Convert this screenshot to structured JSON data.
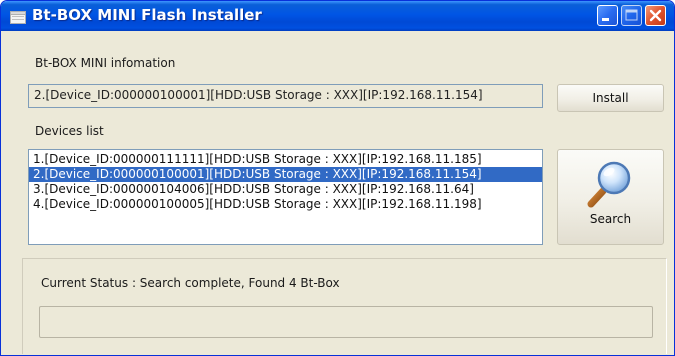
{
  "window": {
    "title": "Bt-BOX MINI Flash Installer"
  },
  "info": {
    "section_label": "Bt-BOX MINI infomation",
    "current_device": "2.[Device_ID:000000100001][HDD:USB Storage : XXX][IP:192.168.11.154]",
    "install_label": "Install"
  },
  "devices": {
    "section_label": "Devices list",
    "selected_index": 1,
    "items": [
      {
        "label": "1.[Device_ID:000000111111][HDD:USB Storage : XXX][IP:192.168.11.185]"
      },
      {
        "label": "2.[Device_ID:000000100001][HDD:USB Storage : XXX][IP:192.168.11.154]"
      },
      {
        "label": "3.[Device_ID:000000104006][HDD:USB Storage : XXX][IP:192.168.11.64]"
      },
      {
        "label": "4.[Device_ID:000000100005][HDD:USB Storage : XXX][IP:192.168.11.198]"
      }
    ],
    "search_label": "Search",
    "search_icon": "magnifier-icon"
  },
  "status": {
    "text": "Current Status : Search complete, Found 4 Bt-Box",
    "progress": 0
  },
  "colors": {
    "titlebar": "#0055e5",
    "selection": "#316ac5",
    "window_bg": "#ece9d8",
    "close_button": "#e0532d"
  }
}
